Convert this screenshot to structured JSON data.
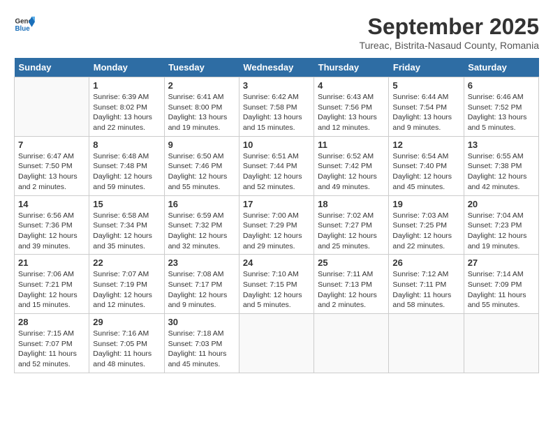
{
  "header": {
    "logo_general": "General",
    "logo_blue": "Blue",
    "month_title": "September 2025",
    "location": "Tureac, Bistrita-Nasaud County, Romania"
  },
  "weekdays": [
    "Sunday",
    "Monday",
    "Tuesday",
    "Wednesday",
    "Thursday",
    "Friday",
    "Saturday"
  ],
  "weeks": [
    [
      {
        "day": "",
        "info": ""
      },
      {
        "day": "1",
        "info": "Sunrise: 6:39 AM\nSunset: 8:02 PM\nDaylight: 13 hours\nand 22 minutes."
      },
      {
        "day": "2",
        "info": "Sunrise: 6:41 AM\nSunset: 8:00 PM\nDaylight: 13 hours\nand 19 minutes."
      },
      {
        "day": "3",
        "info": "Sunrise: 6:42 AM\nSunset: 7:58 PM\nDaylight: 13 hours\nand 15 minutes."
      },
      {
        "day": "4",
        "info": "Sunrise: 6:43 AM\nSunset: 7:56 PM\nDaylight: 13 hours\nand 12 minutes."
      },
      {
        "day": "5",
        "info": "Sunrise: 6:44 AM\nSunset: 7:54 PM\nDaylight: 13 hours\nand 9 minutes."
      },
      {
        "day": "6",
        "info": "Sunrise: 6:46 AM\nSunset: 7:52 PM\nDaylight: 13 hours\nand 5 minutes."
      }
    ],
    [
      {
        "day": "7",
        "info": "Sunrise: 6:47 AM\nSunset: 7:50 PM\nDaylight: 13 hours\nand 2 minutes."
      },
      {
        "day": "8",
        "info": "Sunrise: 6:48 AM\nSunset: 7:48 PM\nDaylight: 12 hours\nand 59 minutes."
      },
      {
        "day": "9",
        "info": "Sunrise: 6:50 AM\nSunset: 7:46 PM\nDaylight: 12 hours\nand 55 minutes."
      },
      {
        "day": "10",
        "info": "Sunrise: 6:51 AM\nSunset: 7:44 PM\nDaylight: 12 hours\nand 52 minutes."
      },
      {
        "day": "11",
        "info": "Sunrise: 6:52 AM\nSunset: 7:42 PM\nDaylight: 12 hours\nand 49 minutes."
      },
      {
        "day": "12",
        "info": "Sunrise: 6:54 AM\nSunset: 7:40 PM\nDaylight: 12 hours\nand 45 minutes."
      },
      {
        "day": "13",
        "info": "Sunrise: 6:55 AM\nSunset: 7:38 PM\nDaylight: 12 hours\nand 42 minutes."
      }
    ],
    [
      {
        "day": "14",
        "info": "Sunrise: 6:56 AM\nSunset: 7:36 PM\nDaylight: 12 hours\nand 39 minutes."
      },
      {
        "day": "15",
        "info": "Sunrise: 6:58 AM\nSunset: 7:34 PM\nDaylight: 12 hours\nand 35 minutes."
      },
      {
        "day": "16",
        "info": "Sunrise: 6:59 AM\nSunset: 7:32 PM\nDaylight: 12 hours\nand 32 minutes."
      },
      {
        "day": "17",
        "info": "Sunrise: 7:00 AM\nSunset: 7:29 PM\nDaylight: 12 hours\nand 29 minutes."
      },
      {
        "day": "18",
        "info": "Sunrise: 7:02 AM\nSunset: 7:27 PM\nDaylight: 12 hours\nand 25 minutes."
      },
      {
        "day": "19",
        "info": "Sunrise: 7:03 AM\nSunset: 7:25 PM\nDaylight: 12 hours\nand 22 minutes."
      },
      {
        "day": "20",
        "info": "Sunrise: 7:04 AM\nSunset: 7:23 PM\nDaylight: 12 hours\nand 19 minutes."
      }
    ],
    [
      {
        "day": "21",
        "info": "Sunrise: 7:06 AM\nSunset: 7:21 PM\nDaylight: 12 hours\nand 15 minutes."
      },
      {
        "day": "22",
        "info": "Sunrise: 7:07 AM\nSunset: 7:19 PM\nDaylight: 12 hours\nand 12 minutes."
      },
      {
        "day": "23",
        "info": "Sunrise: 7:08 AM\nSunset: 7:17 PM\nDaylight: 12 hours\nand 9 minutes."
      },
      {
        "day": "24",
        "info": "Sunrise: 7:10 AM\nSunset: 7:15 PM\nDaylight: 12 hours\nand 5 minutes."
      },
      {
        "day": "25",
        "info": "Sunrise: 7:11 AM\nSunset: 7:13 PM\nDaylight: 12 hours\nand 2 minutes."
      },
      {
        "day": "26",
        "info": "Sunrise: 7:12 AM\nSunset: 7:11 PM\nDaylight: 11 hours\nand 58 minutes."
      },
      {
        "day": "27",
        "info": "Sunrise: 7:14 AM\nSunset: 7:09 PM\nDaylight: 11 hours\nand 55 minutes."
      }
    ],
    [
      {
        "day": "28",
        "info": "Sunrise: 7:15 AM\nSunset: 7:07 PM\nDaylight: 11 hours\nand 52 minutes."
      },
      {
        "day": "29",
        "info": "Sunrise: 7:16 AM\nSunset: 7:05 PM\nDaylight: 11 hours\nand 48 minutes."
      },
      {
        "day": "30",
        "info": "Sunrise: 7:18 AM\nSunset: 7:03 PM\nDaylight: 11 hours\nand 45 minutes."
      },
      {
        "day": "",
        "info": ""
      },
      {
        "day": "",
        "info": ""
      },
      {
        "day": "",
        "info": ""
      },
      {
        "day": "",
        "info": ""
      }
    ]
  ]
}
